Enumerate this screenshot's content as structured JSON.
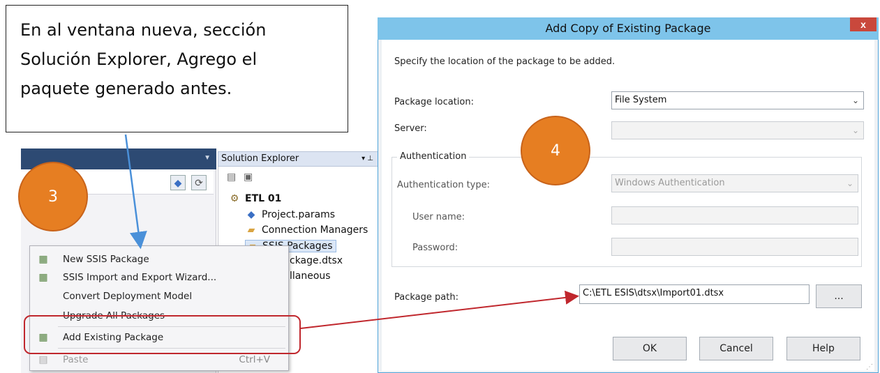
{
  "callout": {
    "lines": [
      "En al ventana nueva, sección",
      "Solución Explorer, Agrego el",
      "paquete generado antes."
    ]
  },
  "steps": {
    "left": "3",
    "right": "4"
  },
  "solution_explorer": {
    "title": "Solution Explorer",
    "items": [
      "ETL 01",
      "Project.params",
      "Connection Managers",
      "SSIS Packages",
      "ckage.dtsx",
      "llaneous"
    ]
  },
  "context_menu": {
    "items": [
      {
        "label": "New SSIS Package",
        "icon": "new-package-icon"
      },
      {
        "label": "SSIS Import and Export Wizard...",
        "icon": "wizard-icon"
      },
      {
        "label": "Convert Deployment Model",
        "icon": ""
      },
      {
        "label": "Upgrade All Packages",
        "icon": ""
      },
      {
        "label": "Add Existing Package",
        "icon": "add-package-icon"
      },
      {
        "label": "Paste",
        "icon": "paste-icon",
        "shortcut": "Ctrl+V"
      }
    ]
  },
  "dialog": {
    "title": "Add Copy of Existing Package",
    "close": "x",
    "description": "Specify the location of the package to be added.",
    "package_location_label": "Package location:",
    "package_location_value": "File System",
    "server_label": "Server:",
    "server_value": "",
    "auth_group": "Authentication",
    "auth_type_label": "Authentication type:",
    "auth_type_value": "Windows Authentication",
    "username_label": "User name:",
    "password_label": "Password:",
    "package_path_label": "Package path:",
    "package_path_value": "C:\\ETL ESIS\\dtsx\\Import01.dtsx",
    "browse": "...",
    "ok": "OK",
    "cancel": "Cancel",
    "help": "Help"
  },
  "colors": {
    "accent": "#e67e22",
    "highlight": "#c0272d",
    "arrow_blue": "#4a90d9",
    "title_bar": "#7ec4ea"
  }
}
